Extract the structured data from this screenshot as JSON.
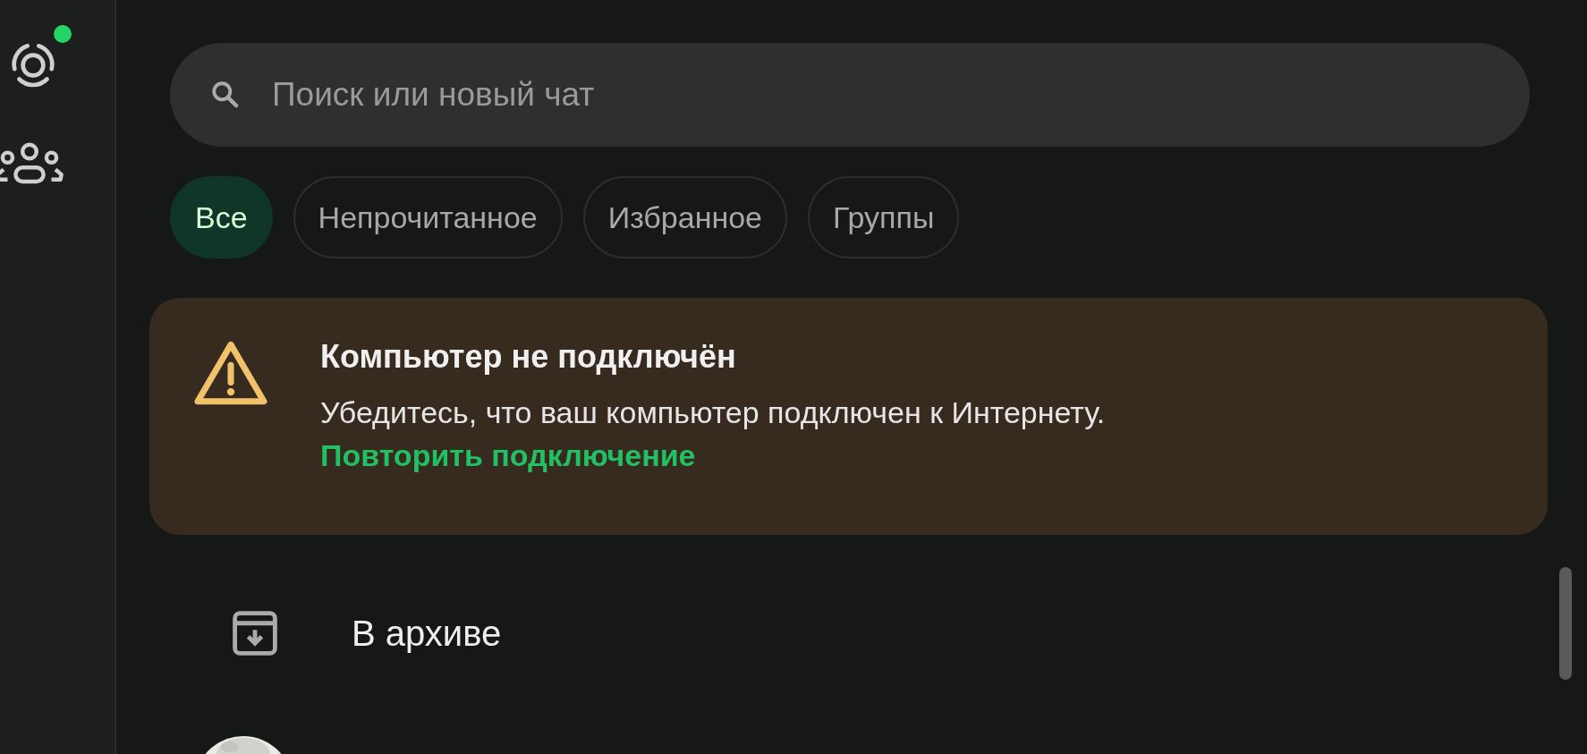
{
  "rail": {
    "items": [
      {
        "kind": "status",
        "has_update": true
      },
      {
        "kind": "communities",
        "has_update": false
      }
    ]
  },
  "search": {
    "placeholder": "Поиск или новый чат"
  },
  "filters": [
    {
      "label": "Все",
      "selected": true
    },
    {
      "label": "Непрочитанное",
      "selected": false
    },
    {
      "label": "Избранное",
      "selected": false
    },
    {
      "label": "Группы",
      "selected": false
    }
  ],
  "banner": {
    "title": "Компьютер не подключён",
    "message": "Убедитесь, что ваш компьютер подключен к Интернету.",
    "action": "Повторить подключение"
  },
  "chat_list": [
    {
      "kind": "archive",
      "label": "В архиве"
    },
    {
      "kind": "chat"
    }
  ]
}
